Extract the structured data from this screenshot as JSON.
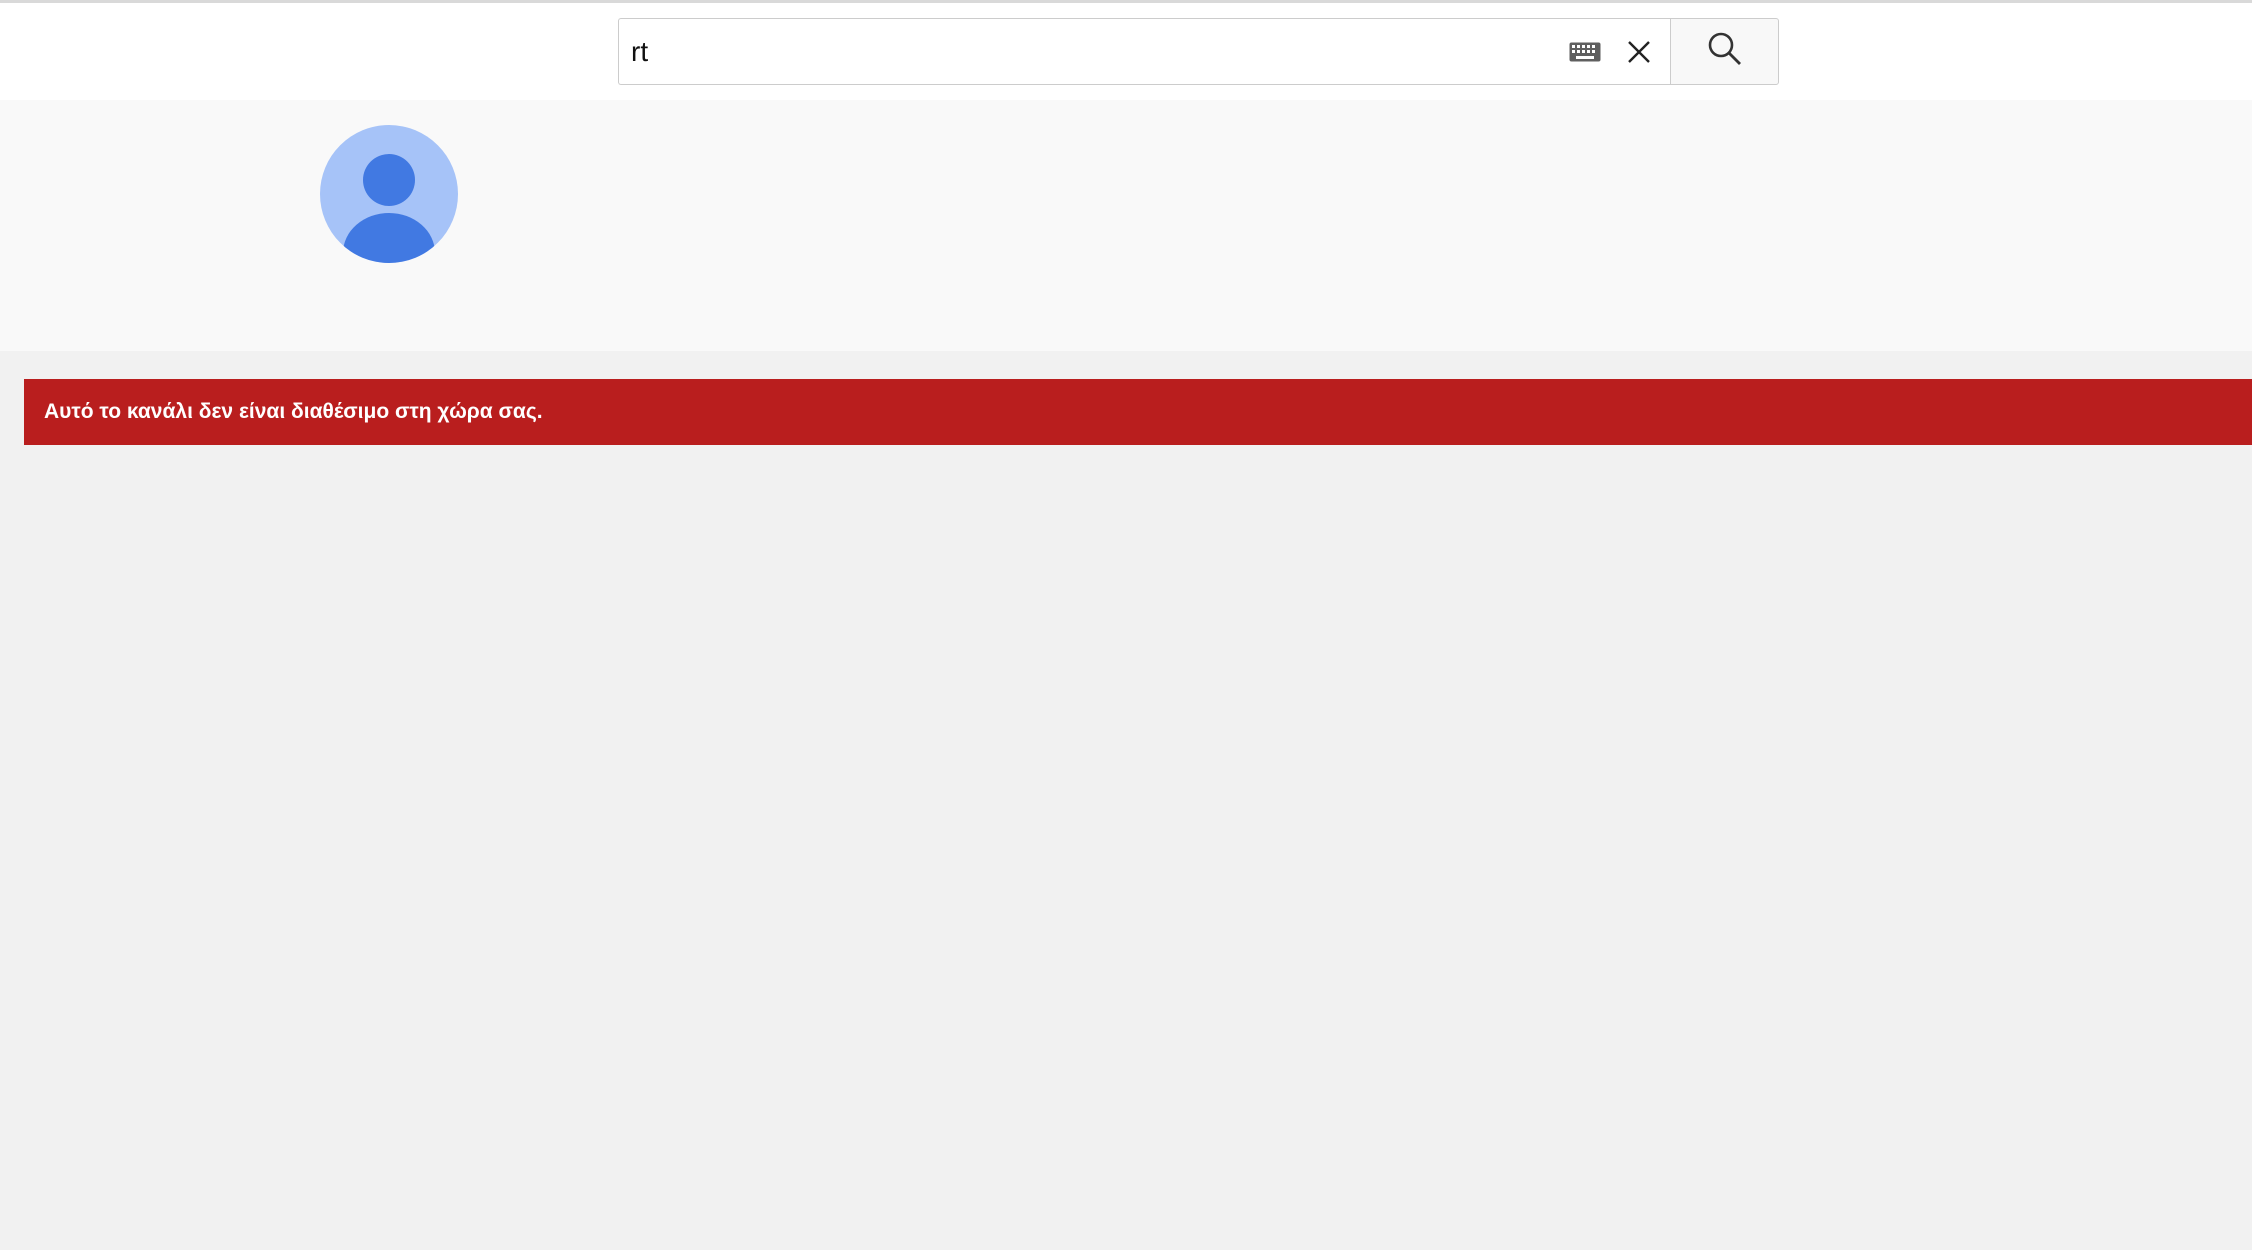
{
  "search": {
    "value": "rt",
    "keyboard_icon": "keyboard-icon",
    "clear_icon": "close-icon",
    "button_icon": "search-icon"
  },
  "channel": {
    "avatar_icon": "default-user-avatar"
  },
  "alert": {
    "message": "Αυτό το κανάλι δεν είναι διαθέσιμο στη χώρα σας."
  },
  "colors": {
    "alert_bg": "#b91e1e",
    "avatar_bg": "#a6c3f8",
    "avatar_fg": "#4179e2",
    "page_bg": "#f1f1f1"
  }
}
